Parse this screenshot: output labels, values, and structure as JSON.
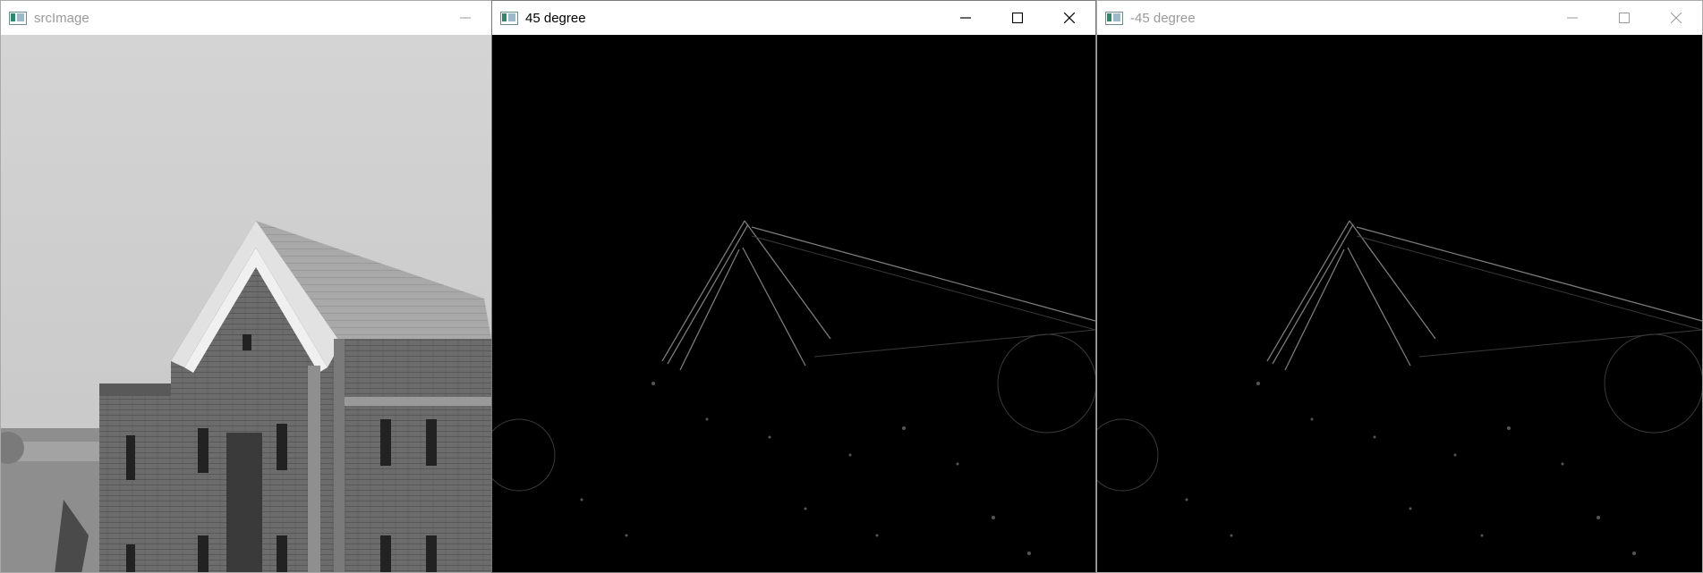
{
  "windows": [
    {
      "id": "src",
      "title": "srcImage",
      "active": false,
      "image_description_icon": "photo-building-grayscale"
    },
    {
      "id": "deg45",
      "title": "45 degree",
      "active": true,
      "image_description_icon": "edge-filter-output"
    },
    {
      "id": "degm45",
      "title": "-45 degree",
      "active": false,
      "image_description_icon": "edge-filter-output"
    }
  ],
  "icons": {
    "app": "opencv-window-icon",
    "minimize": "minimize-icon",
    "maximize": "maximize-icon",
    "close": "close-icon"
  },
  "colors": {
    "titlebar_bg": "#ffffff",
    "active_title": "#000000",
    "inactive_title": "#9a9a9a",
    "canvas_bg": "#000000"
  }
}
